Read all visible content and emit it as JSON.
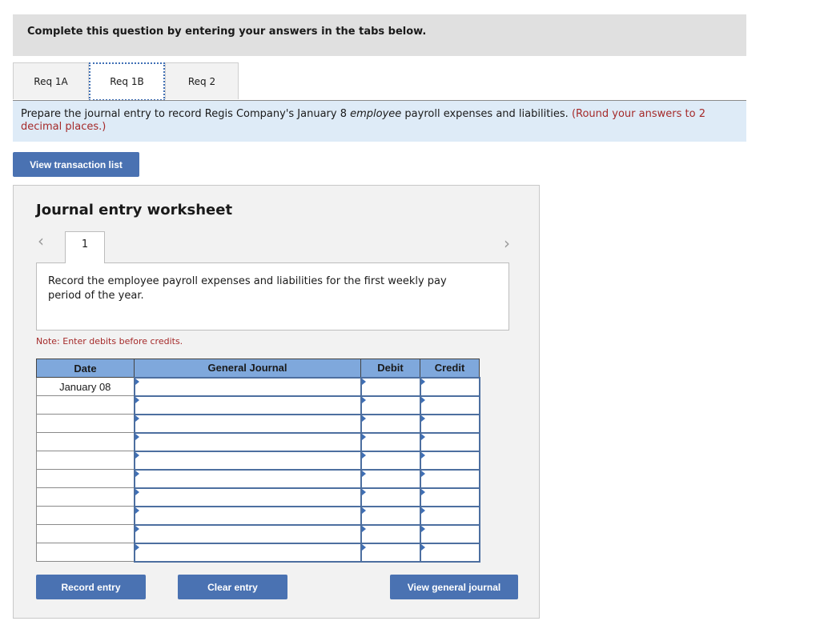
{
  "banner": {
    "text": "Complete this question by entering your answers in the tabs below."
  },
  "tabs": [
    {
      "label": "Req 1A",
      "active": false
    },
    {
      "label": "Req 1B",
      "active": true
    },
    {
      "label": "Req 2",
      "active": false
    }
  ],
  "instructions": {
    "part1": "Prepare the journal entry to record Regis Company's January 8 ",
    "italic": "employee",
    "part2": " payroll expenses and liabilities. ",
    "red": "(Round your answers to 2 decimal places.)"
  },
  "buttons": {
    "view_transaction_list": "View transaction list",
    "record_entry": "Record entry",
    "clear_entry": "Clear entry",
    "view_general_journal": "View general journal"
  },
  "worksheet": {
    "title": "Journal entry worksheet",
    "prev_icon": "‹",
    "next_icon": "›",
    "entry_tab": "1",
    "description": "Record the employee payroll expenses and liabilities for the first weekly pay period of the year.",
    "note": "Note: Enter debits before credits.",
    "columns": [
      "Date",
      "General Journal",
      "Debit",
      "Credit"
    ],
    "rows": [
      {
        "date": "January 08",
        "account": "",
        "debit": "",
        "credit": ""
      },
      {
        "date": "",
        "account": "",
        "debit": "",
        "credit": ""
      },
      {
        "date": "",
        "account": "",
        "debit": "",
        "credit": ""
      },
      {
        "date": "",
        "account": "",
        "debit": "",
        "credit": ""
      },
      {
        "date": "",
        "account": "",
        "debit": "",
        "credit": ""
      },
      {
        "date": "",
        "account": "",
        "debit": "",
        "credit": ""
      },
      {
        "date": "",
        "account": "",
        "debit": "",
        "credit": ""
      },
      {
        "date": "",
        "account": "",
        "debit": "",
        "credit": ""
      },
      {
        "date": "",
        "account": "",
        "debit": "",
        "credit": ""
      },
      {
        "date": "",
        "account": "",
        "debit": "",
        "credit": ""
      }
    ]
  },
  "colors": {
    "button_blue": "#4a72b2",
    "header_blue": "#7fa8dc",
    "instruction_bg": "#deebf7",
    "note_red": "#a52a2a"
  }
}
